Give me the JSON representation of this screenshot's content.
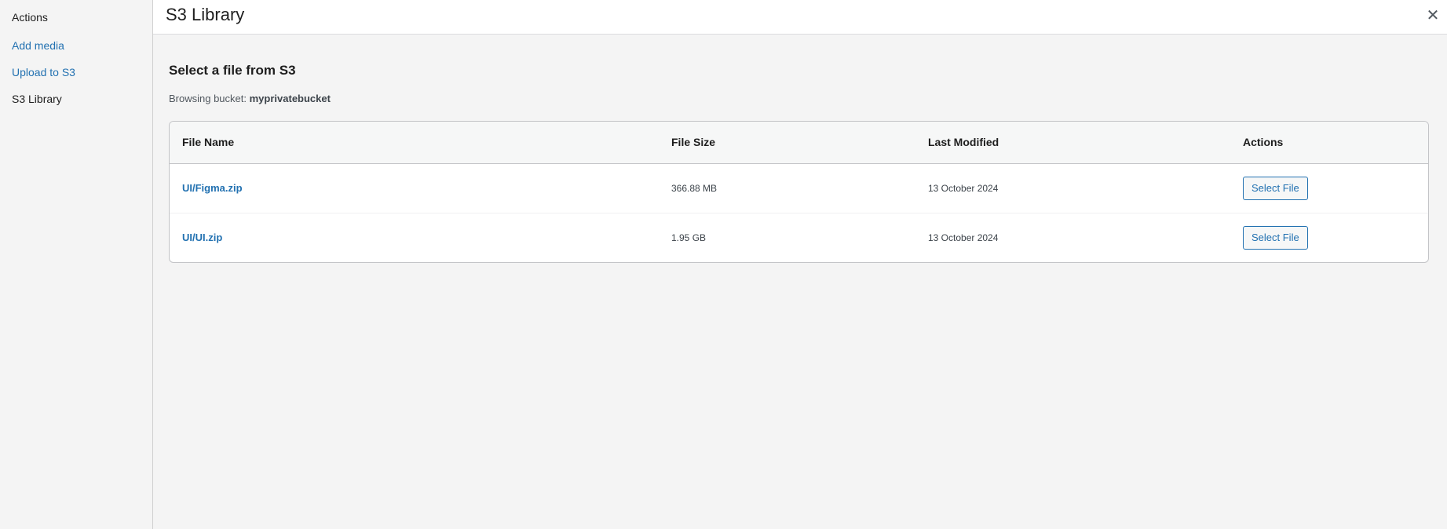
{
  "sidebar": {
    "heading": "Actions",
    "items": [
      {
        "label": "Add media",
        "active": false
      },
      {
        "label": "Upload to S3",
        "active": false
      },
      {
        "label": "S3 Library",
        "active": true
      }
    ]
  },
  "header": {
    "title": "S3 Library",
    "close_icon": "close-icon"
  },
  "main": {
    "section_title": "Select a file from S3",
    "bucket_label": "Browsing bucket:",
    "bucket_name": "myprivatebucket",
    "table": {
      "columns": [
        "File Name",
        "File Size",
        "Last Modified",
        "Actions"
      ],
      "rows": [
        {
          "name": "UI/Figma.zip",
          "size": "366.88 MB",
          "modified": "13 October 2024",
          "action": "Select File"
        },
        {
          "name": "UI/UI.zip",
          "size": "1.95 GB",
          "modified": "13 October 2024",
          "action": "Select File"
        }
      ]
    }
  },
  "colors": {
    "link": "#2271b1",
    "background": "#f4f4f4",
    "panel": "#ffffff",
    "border": "#c3c4c7"
  }
}
